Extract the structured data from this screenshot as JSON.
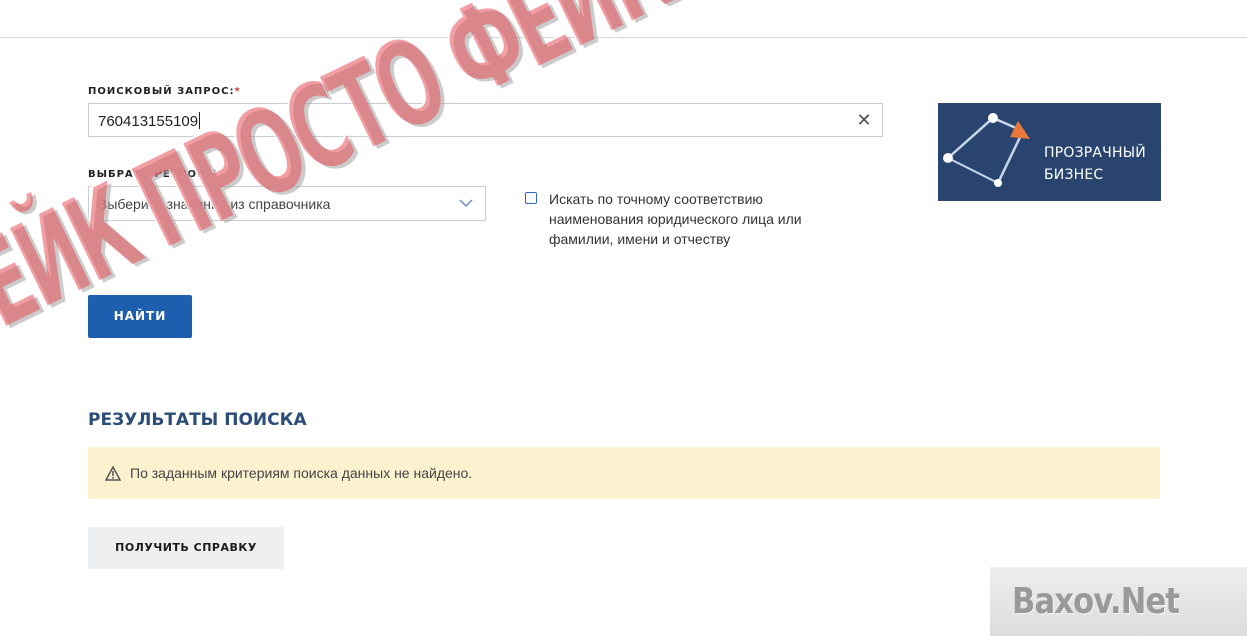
{
  "search": {
    "label": "ПОИСКОВЫЙ ЗАПРОС:",
    "required_mark": "*",
    "value": "760413155109",
    "clear_icon": "close-icon"
  },
  "regions": {
    "label": "ВЫБРАТЬ РЕГИОНЫ:",
    "placeholder": "Выберите значения из справочника",
    "dropdown_icon": "chevron-down-icon"
  },
  "exact_match": {
    "checked": false,
    "label": "Искать по точному соответствию наименования юридического лица или фамилии, имени и отчеству"
  },
  "find_button": "НАЙТИ",
  "results": {
    "title": "РЕЗУЛЬТАТЫ ПОИСКА",
    "alert_icon": "warning-icon",
    "alert_text": "По заданным критериям поиска данных не найдено."
  },
  "certificate_button": "ПОЛУЧИТЬ СПРАВКУ",
  "logo": {
    "line1": "ПРОЗРАЧНЫЙ",
    "line2": "БИЗНЕС"
  },
  "overlay_stamp": "ФЕЙК ПРОСТО ФЕЙК",
  "watermark": "Baxov.Net",
  "colors": {
    "primary_button": "#1d5fae",
    "alert_bg": "#fdf2cf",
    "stamp": "#e85058",
    "logo_bg": "#29456f",
    "logo_accent": "#e8773a"
  }
}
